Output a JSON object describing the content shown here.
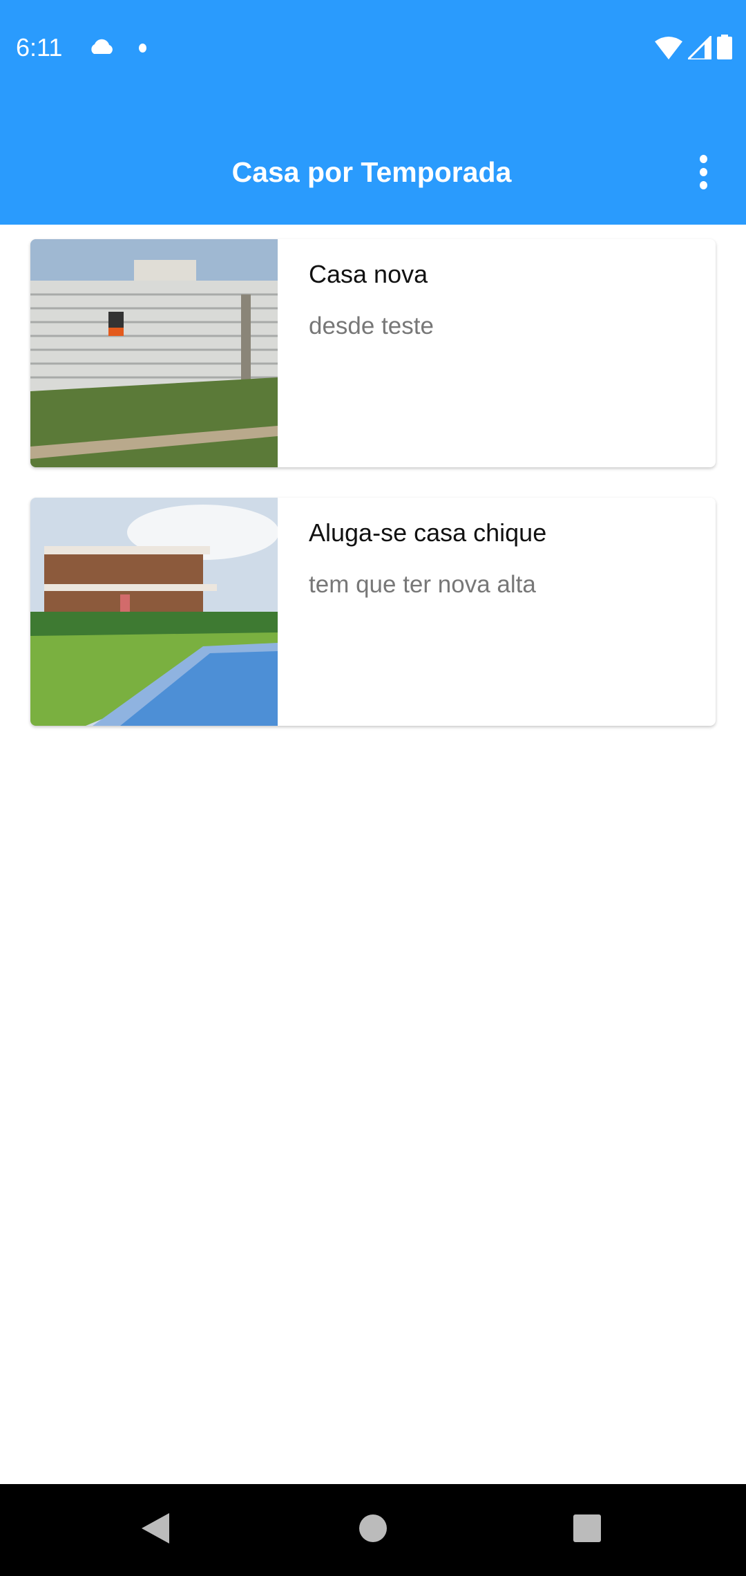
{
  "status_bar": {
    "time": "6:11",
    "icons": [
      "cloud-icon",
      "notification-dot-icon",
      "wifi-icon",
      "signal-icon",
      "battery-icon"
    ]
  },
  "app_bar": {
    "title": "Casa por Temporada",
    "menu_icon": "more-vert-icon",
    "color": "#2a9bfd"
  },
  "listings": [
    {
      "title": "Casa nova",
      "description": "desde teste"
    },
    {
      "title": "Aluga-se casa chique",
      "description": "tem que ter nova alta"
    }
  ],
  "nav_bar": {
    "icons": [
      "back-icon",
      "home-icon",
      "recents-icon"
    ]
  }
}
